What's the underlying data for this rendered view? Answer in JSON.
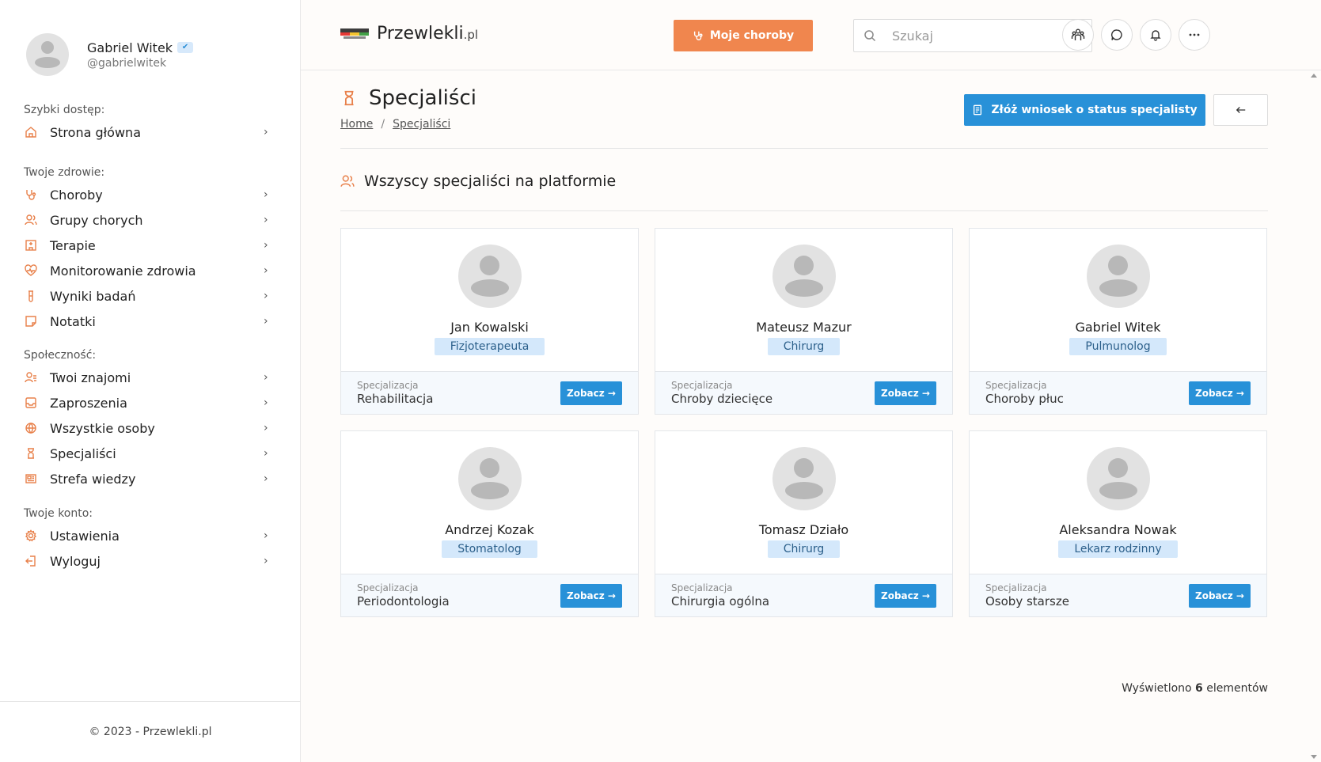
{
  "user": {
    "name": "Gabriel Witek",
    "handle": "@gabrielwitek",
    "verified_icon": "check-icon"
  },
  "sidebar": {
    "sections": [
      {
        "title": "Szybki dostęp:",
        "items": [
          {
            "label": "Strona główna",
            "icon": "home-icon"
          }
        ]
      },
      {
        "title": "Twoje zdrowie:",
        "items": [
          {
            "label": "Choroby",
            "icon": "stethoscope-icon"
          },
          {
            "label": "Grupy chorych",
            "icon": "users-icon"
          },
          {
            "label": "Terapie",
            "icon": "hospital-icon"
          },
          {
            "label": "Monitorowanie zdrowia",
            "icon": "heart-pulse-icon"
          },
          {
            "label": "Wyniki badań",
            "icon": "test-tube-icon"
          },
          {
            "label": "Notatki",
            "icon": "note-icon"
          }
        ]
      },
      {
        "title": "Społeczność:",
        "items": [
          {
            "label": "Twoi znajomi",
            "icon": "user-list-icon"
          },
          {
            "label": "Zaproszenia",
            "icon": "inbox-icon"
          },
          {
            "label": "Wszystkie osoby",
            "icon": "globe-icon"
          },
          {
            "label": "Specjaliści",
            "icon": "hourglass-icon"
          },
          {
            "label": "Strefa wiedzy",
            "icon": "newspaper-icon"
          }
        ]
      },
      {
        "title": "Twoje konto:",
        "items": [
          {
            "label": "Ustawienia",
            "icon": "gear-icon"
          },
          {
            "label": "Wyloguj",
            "icon": "logout-icon"
          }
        ]
      }
    ],
    "footer": "© 2023 - Przewlekli.pl"
  },
  "header": {
    "logo_text": "Przewlekli",
    "logo_suffix": ".pl",
    "diseases_button": "Moje choroby",
    "search_placeholder": "Szukaj",
    "icons": [
      "people-icon",
      "chat-icon",
      "bell-icon",
      "more-icon"
    ]
  },
  "page": {
    "title": "Specjaliści",
    "breadcrumb": {
      "home": "Home",
      "separator": "/",
      "current": "Specjaliści"
    },
    "apply_button": "Złóż wniosek o status specjalisty",
    "section_title": "Wszyscy specjaliści na platformie",
    "spec_label": "Specjalizacja",
    "view_button": "Zobacz →",
    "count_prefix": "Wyświetlono",
    "count_value": "6",
    "count_suffix": "elementów"
  },
  "specialists": [
    {
      "name": "Jan Kowalski",
      "role": "Fizjoterapeuta",
      "specialization": "Rehabilitacja"
    },
    {
      "name": "Mateusz Mazur",
      "role": "Chirurg",
      "specialization": "Chroby dziecięce"
    },
    {
      "name": "Gabriel Witek",
      "role": "Pulmunolog",
      "specialization": "Choroby płuc"
    },
    {
      "name": "Andrzej Kozak",
      "role": "Stomatolog",
      "specialization": "Periodontologia"
    },
    {
      "name": "Tomasz Działo",
      "role": "Chirurg",
      "specialization": "Chirurgia ogólna"
    },
    {
      "name": "Aleksandra Nowak",
      "role": "Lekarz rodzinny",
      "specialization": "Osoby starsze"
    }
  ],
  "colors": {
    "accent": "#f0864e",
    "primary": "#2891d8",
    "badge_bg": "#d4e8fb"
  }
}
